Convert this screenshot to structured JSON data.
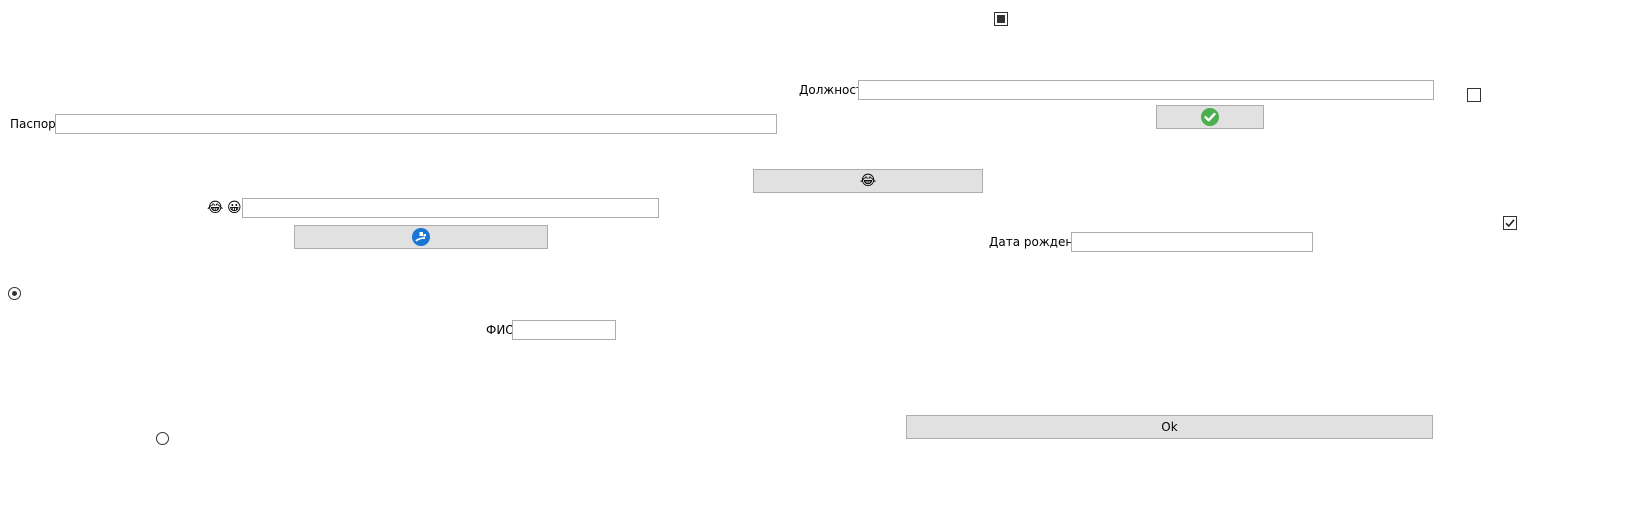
{
  "form": {
    "position_label": "Должность",
    "position_value": "",
    "passport_label": "Паспорт",
    "passport_value": "",
    "emoji_label_1": "😂",
    "emoji_label_2": "😀",
    "emoji_field_value": "",
    "birthdate_label": "Дата рождения",
    "birthdate_value": "",
    "fio_label": "ФИО",
    "fio_value": "",
    "ok_label": "Ok",
    "emoji_button_glyph": "😂"
  },
  "checkboxes": {
    "top_state": "indeterminate",
    "right_top_state": "unchecked",
    "right_bottom_state": "checked"
  },
  "radios": {
    "left_state": "selected",
    "bottom_state": "unselected"
  },
  "icons": {
    "confirm_button_icon": "check-circle-icon",
    "share_button_icon": "blue-circle-share-icon"
  },
  "colors": {
    "button_bg": "#e1e1e1",
    "check_green": "#4cae4f",
    "share_blue": "#1976d2"
  }
}
